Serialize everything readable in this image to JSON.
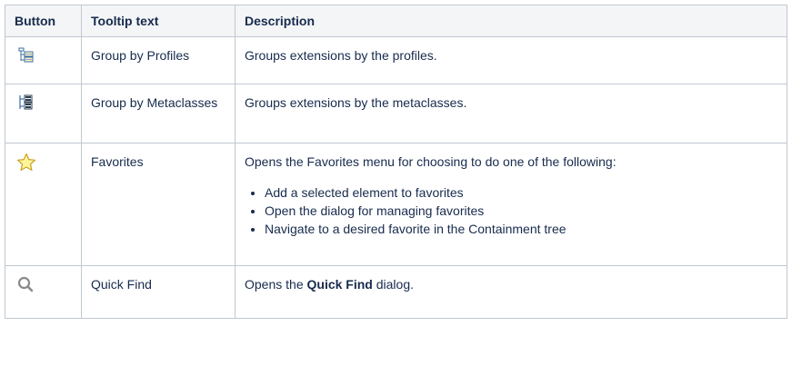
{
  "table": {
    "headers": [
      "Button",
      "Tooltip text",
      "Description"
    ],
    "rows": [
      {
        "icon": "group-by-profiles-icon",
        "tooltip": "Group by Profiles",
        "description": "Groups extensions by the profiles."
      },
      {
        "icon": "group-by-metaclasses-icon",
        "tooltip": "Group by Metaclasses",
        "description": "Groups extensions by the metaclasses."
      },
      {
        "icon": "star-icon",
        "tooltip": "Favorites",
        "description": "Opens the Favorites menu for choosing to do one of the following:",
        "bullets": [
          "Add a selected element to favorites",
          "Open the dialog for managing favorites",
          "Navigate to a desired favorite in the Containment tree"
        ]
      },
      {
        "icon": "search-icon",
        "tooltip": "Quick Find",
        "description_pre": "Opens the ",
        "description_bold": "Quick Find",
        "description_post": " dialog."
      }
    ]
  },
  "colors": {
    "border": "#c1c7d0",
    "header_bg": "#f4f5f7",
    "text": "#172b4d",
    "icon_blue": "#3b6ea5",
    "star_fill": "#fff176",
    "star_stroke": "#c9a227",
    "search_gray": "#8a8a8a"
  }
}
